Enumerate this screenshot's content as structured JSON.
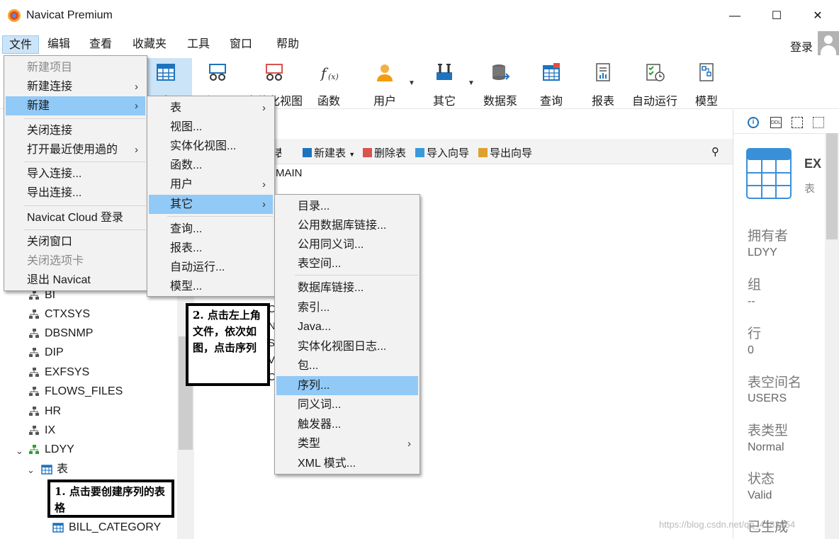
{
  "window": {
    "title": "Navicat Premium",
    "controls": {
      "minimize": "—",
      "maximize": "☐",
      "close": "✕"
    }
  },
  "menubar": {
    "items": [
      "文件",
      "编辑",
      "查看",
      "收藏夹",
      "工具",
      "窗口",
      "帮助"
    ],
    "login": "登录"
  },
  "toolbar": {
    "items": [
      "表",
      "视图",
      "实体化视图",
      "函数",
      "用户",
      "其它",
      "数据泵",
      "查询",
      "报表",
      "自动运行",
      "模型"
    ]
  },
  "object_toolbar": {
    "design": "设计表",
    "new": "新建表",
    "delete": "删除表",
    "import": "导入向导",
    "export": "导出向导"
  },
  "object_list": {
    "visible_text": "MAIN",
    "partial_chars": [
      "O",
      "N",
      "S",
      "V",
      "C"
    ]
  },
  "file_menu": {
    "items": [
      {
        "label": "新建项目",
        "disabled": true
      },
      {
        "label": "新建连接",
        "submenu": true
      },
      {
        "label": "新建",
        "submenu": true,
        "highlighted": true
      },
      {
        "label": "关闭连接"
      },
      {
        "label": "打开最近使用過的",
        "submenu": true
      },
      {
        "label": "导入连接..."
      },
      {
        "label": "导出连接..."
      },
      {
        "label": "Navicat Cloud 登录"
      },
      {
        "label": "关闭窗口"
      },
      {
        "label": "关闭选项卡",
        "disabled": true
      },
      {
        "label": "退出 Navicat"
      }
    ]
  },
  "new_submenu": {
    "items": [
      {
        "label": "表",
        "submenu": true
      },
      {
        "label": "视图..."
      },
      {
        "label": "实体化视图..."
      },
      {
        "label": "函数..."
      },
      {
        "label": "用户",
        "submenu": true
      },
      {
        "label": "其它",
        "submenu": true,
        "highlighted": true
      },
      {
        "label": "查询..."
      },
      {
        "label": "报表..."
      },
      {
        "label": "自动运行..."
      },
      {
        "label": "模型..."
      }
    ]
  },
  "other_submenu": {
    "items": [
      {
        "label": "目录..."
      },
      {
        "label": "公用数据库链接..."
      },
      {
        "label": "公用同义词..."
      },
      {
        "label": "表空间..."
      },
      {
        "label": "数据库链接..."
      },
      {
        "label": "索引..."
      },
      {
        "label": "Java..."
      },
      {
        "label": "实体化视图日志..."
      },
      {
        "label": "包..."
      },
      {
        "label": "序列...",
        "highlighted": true
      },
      {
        "label": "同义词..."
      },
      {
        "label": "触发器..."
      },
      {
        "label": "类型",
        "submenu": true
      },
      {
        "label": "XML 模式..."
      }
    ]
  },
  "tree": {
    "schemas": [
      "BI",
      "CTXSYS",
      "DBSNMP",
      "DIP",
      "EXFSYS",
      "FLOWS_FILES",
      "HR",
      "IX",
      "LDYY"
    ],
    "expanded_schema": "LDYY",
    "tables_node": "表",
    "table": "BILL_CATEGORY"
  },
  "annotations": {
    "note1": "1. 点击要创建序列的表格",
    "note2": "2. 点击左上角文件，依次如图，点击序列"
  },
  "info_panel": {
    "title": "EX",
    "subtitle": "表",
    "fields": [
      {
        "label": "拥有者",
        "value": "LDYY"
      },
      {
        "label": "组",
        "value": "--"
      },
      {
        "label": "行",
        "value": "0"
      },
      {
        "label": "表空间名",
        "value": "USERS"
      },
      {
        "label": "表类型",
        "value": "Normal"
      },
      {
        "label": "状态",
        "value": "Valid"
      },
      {
        "label": "已生成",
        "value": ""
      }
    ]
  },
  "watermark": "https://blog.csdn.net/qq_4182854",
  "colors": {
    "menu_highlight": "#91c9f7",
    "toolbar_selected": "#cce4f7",
    "accent_blue": "#1e73be",
    "schema_icon": "#555555",
    "schema_active_icon": "#2e9e2e"
  }
}
